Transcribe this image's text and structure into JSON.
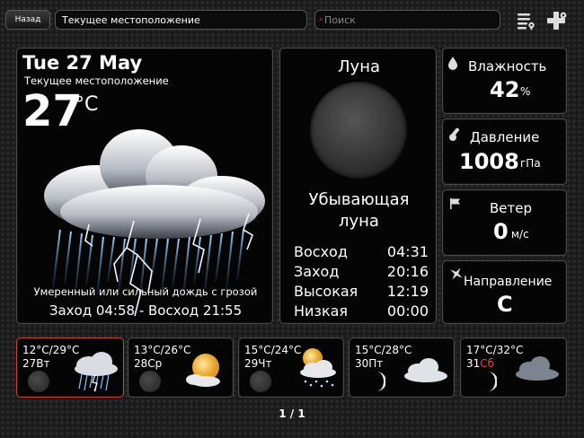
{
  "toolbar": {
    "back_label": "Назад",
    "location_value": "Текущее местоположение",
    "search_placeholder": "Поиск"
  },
  "current": {
    "date": "Tue 27 May",
    "location": "Текущее местоположение",
    "temp": "27",
    "unit": "°C",
    "condition": "Умеренный или сильный дождь с грозой",
    "sun": "Заход 04:58 - Восход 21:55"
  },
  "moon": {
    "title": "Луна",
    "phase": "Убывающая\nлуна",
    "rows": [
      {
        "label": "Восход",
        "value": "04:31"
      },
      {
        "label": "Заход",
        "value": "20:16"
      },
      {
        "label": "Высокая",
        "value": "12:19"
      },
      {
        "label": "Низкая",
        "value": "00:00"
      }
    ]
  },
  "stats": {
    "humidity": {
      "label": "Влажность",
      "value": "42",
      "unit": "%"
    },
    "pressure": {
      "label": "Давление",
      "value": "1008",
      "unit": "гПа"
    },
    "wind": {
      "label": "Ветер",
      "value": "0",
      "unit": "м/с"
    },
    "direction": {
      "label": "Направление",
      "value": "С"
    }
  },
  "forecast": [
    {
      "temp": "12°C/29°C",
      "day": "27Вт",
      "icon": "storm-icon",
      "moon": "dark"
    },
    {
      "temp": "13°C/26°C",
      "day": "28Ср",
      "icon": "sun-cloud-icon",
      "moon": "dark"
    },
    {
      "temp": "15°C/24°C",
      "day": "29Чт",
      "icon": "sun-snow-icon",
      "moon": "dark"
    },
    {
      "temp": "15°C/28°C",
      "day": "30Пт",
      "icon": "cloud-icon",
      "moon": "crescent"
    },
    {
      "temp": "17°C/32°C",
      "day": "31",
      "day_suffix": "Сб",
      "icon": "fog-cloud-icon",
      "moon": "crescent"
    }
  ],
  "pager": "1 / 1",
  "colors": {
    "accent_border": "#c0443a",
    "saturday": "#e8453c"
  }
}
